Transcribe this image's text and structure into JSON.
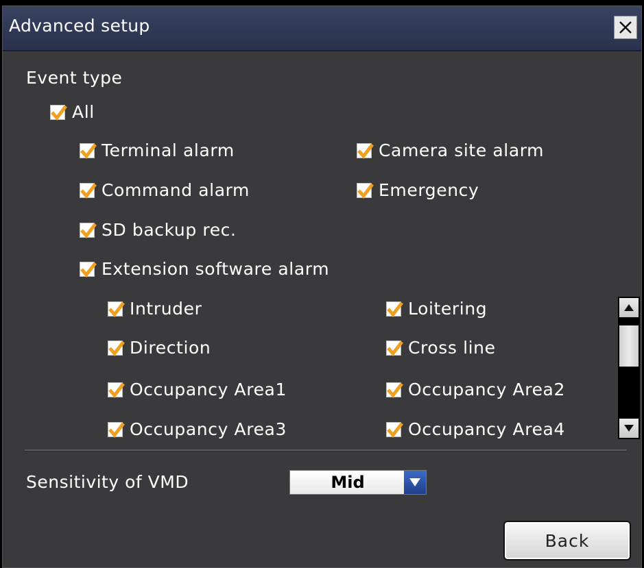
{
  "dialog": {
    "title": "Advanced setup"
  },
  "event_type": {
    "label": "Event type",
    "all": {
      "label": "All",
      "checked": true
    },
    "items": [
      {
        "label": "Terminal alarm",
        "checked": true
      },
      {
        "label": "Camera site alarm",
        "checked": true
      },
      {
        "label": "Command alarm",
        "checked": true
      },
      {
        "label": "Emergency",
        "checked": true
      },
      {
        "label": "SD backup rec.",
        "checked": true
      },
      {
        "label": "Extension software alarm",
        "checked": true
      }
    ],
    "extension_items": [
      {
        "label": "Intruder",
        "checked": true
      },
      {
        "label": "Loitering",
        "checked": true
      },
      {
        "label": "Direction",
        "checked": true
      },
      {
        "label": "Cross line",
        "checked": true
      },
      {
        "label": "Occupancy Area1",
        "checked": true
      },
      {
        "label": "Occupancy Area2",
        "checked": true
      },
      {
        "label": "Occupancy Area3",
        "checked": true
      },
      {
        "label": "Occupancy Area4",
        "checked": true
      }
    ]
  },
  "sensitivity": {
    "label": "Sensitivity of VMD",
    "value": "Mid"
  },
  "buttons": {
    "back": "Back"
  },
  "colors": {
    "check": "#f0a020",
    "title_bar": "#2f3855",
    "panel": "#3a3a3c"
  }
}
